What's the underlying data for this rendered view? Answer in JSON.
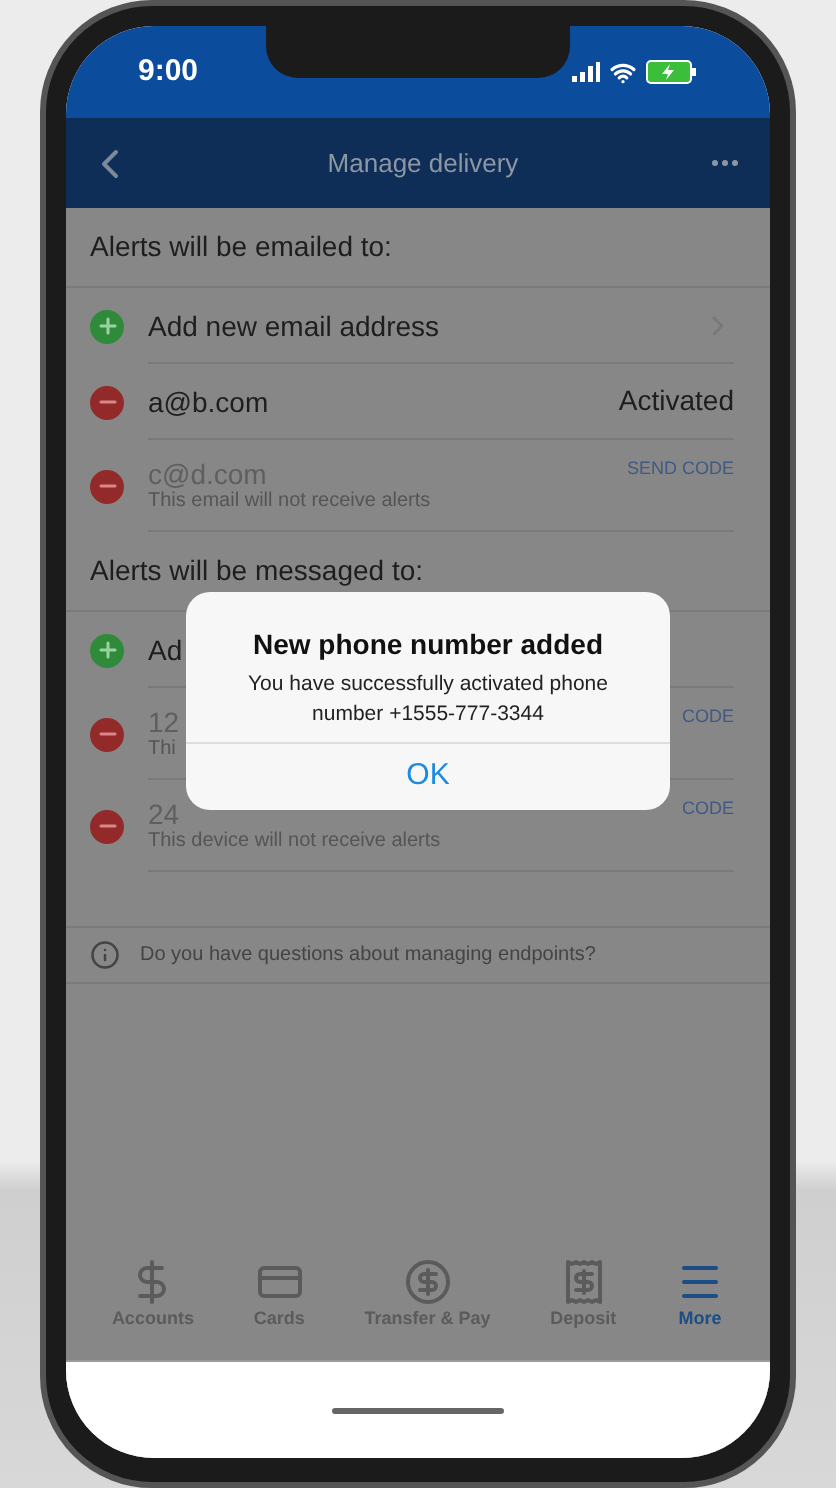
{
  "status_bar": {
    "time": "9:00"
  },
  "nav": {
    "title": "Manage delivery"
  },
  "email_section": {
    "heading": "Alerts will be emailed to:",
    "rows": [
      {
        "kind": "add",
        "label": "Add new email address"
      },
      {
        "kind": "remove",
        "label": "a@b.com",
        "status": "Activated",
        "disabled": false
      },
      {
        "kind": "remove",
        "label": "c@d.com",
        "sublabel": "This email will not receive alerts",
        "action": "SEND CODE",
        "disabled": true
      }
    ]
  },
  "sms_section": {
    "heading": "Alerts will be messaged to:",
    "rows": [
      {
        "kind": "add",
        "label": "Ad"
      },
      {
        "kind": "remove",
        "label": "12",
        "sublabel": "Thi",
        "action": "CODE",
        "disabled": true
      },
      {
        "kind": "remove",
        "label": "24",
        "sublabel": "This device will not receive alerts",
        "action": "CODE",
        "disabled": true
      }
    ]
  },
  "info": {
    "text": "Do you have questions about managing endpoints?"
  },
  "tab_bar": [
    {
      "label": "Accounts",
      "selected": false
    },
    {
      "label": "Cards",
      "selected": false
    },
    {
      "label": "Transfer & Pay",
      "selected": false
    },
    {
      "label": "Deposit",
      "selected": false
    },
    {
      "label": "More",
      "selected": true
    }
  ],
  "dialog": {
    "title": "New phone number added",
    "message": "You have successfully activated phone number +1555-777-3344",
    "button": "OK"
  }
}
